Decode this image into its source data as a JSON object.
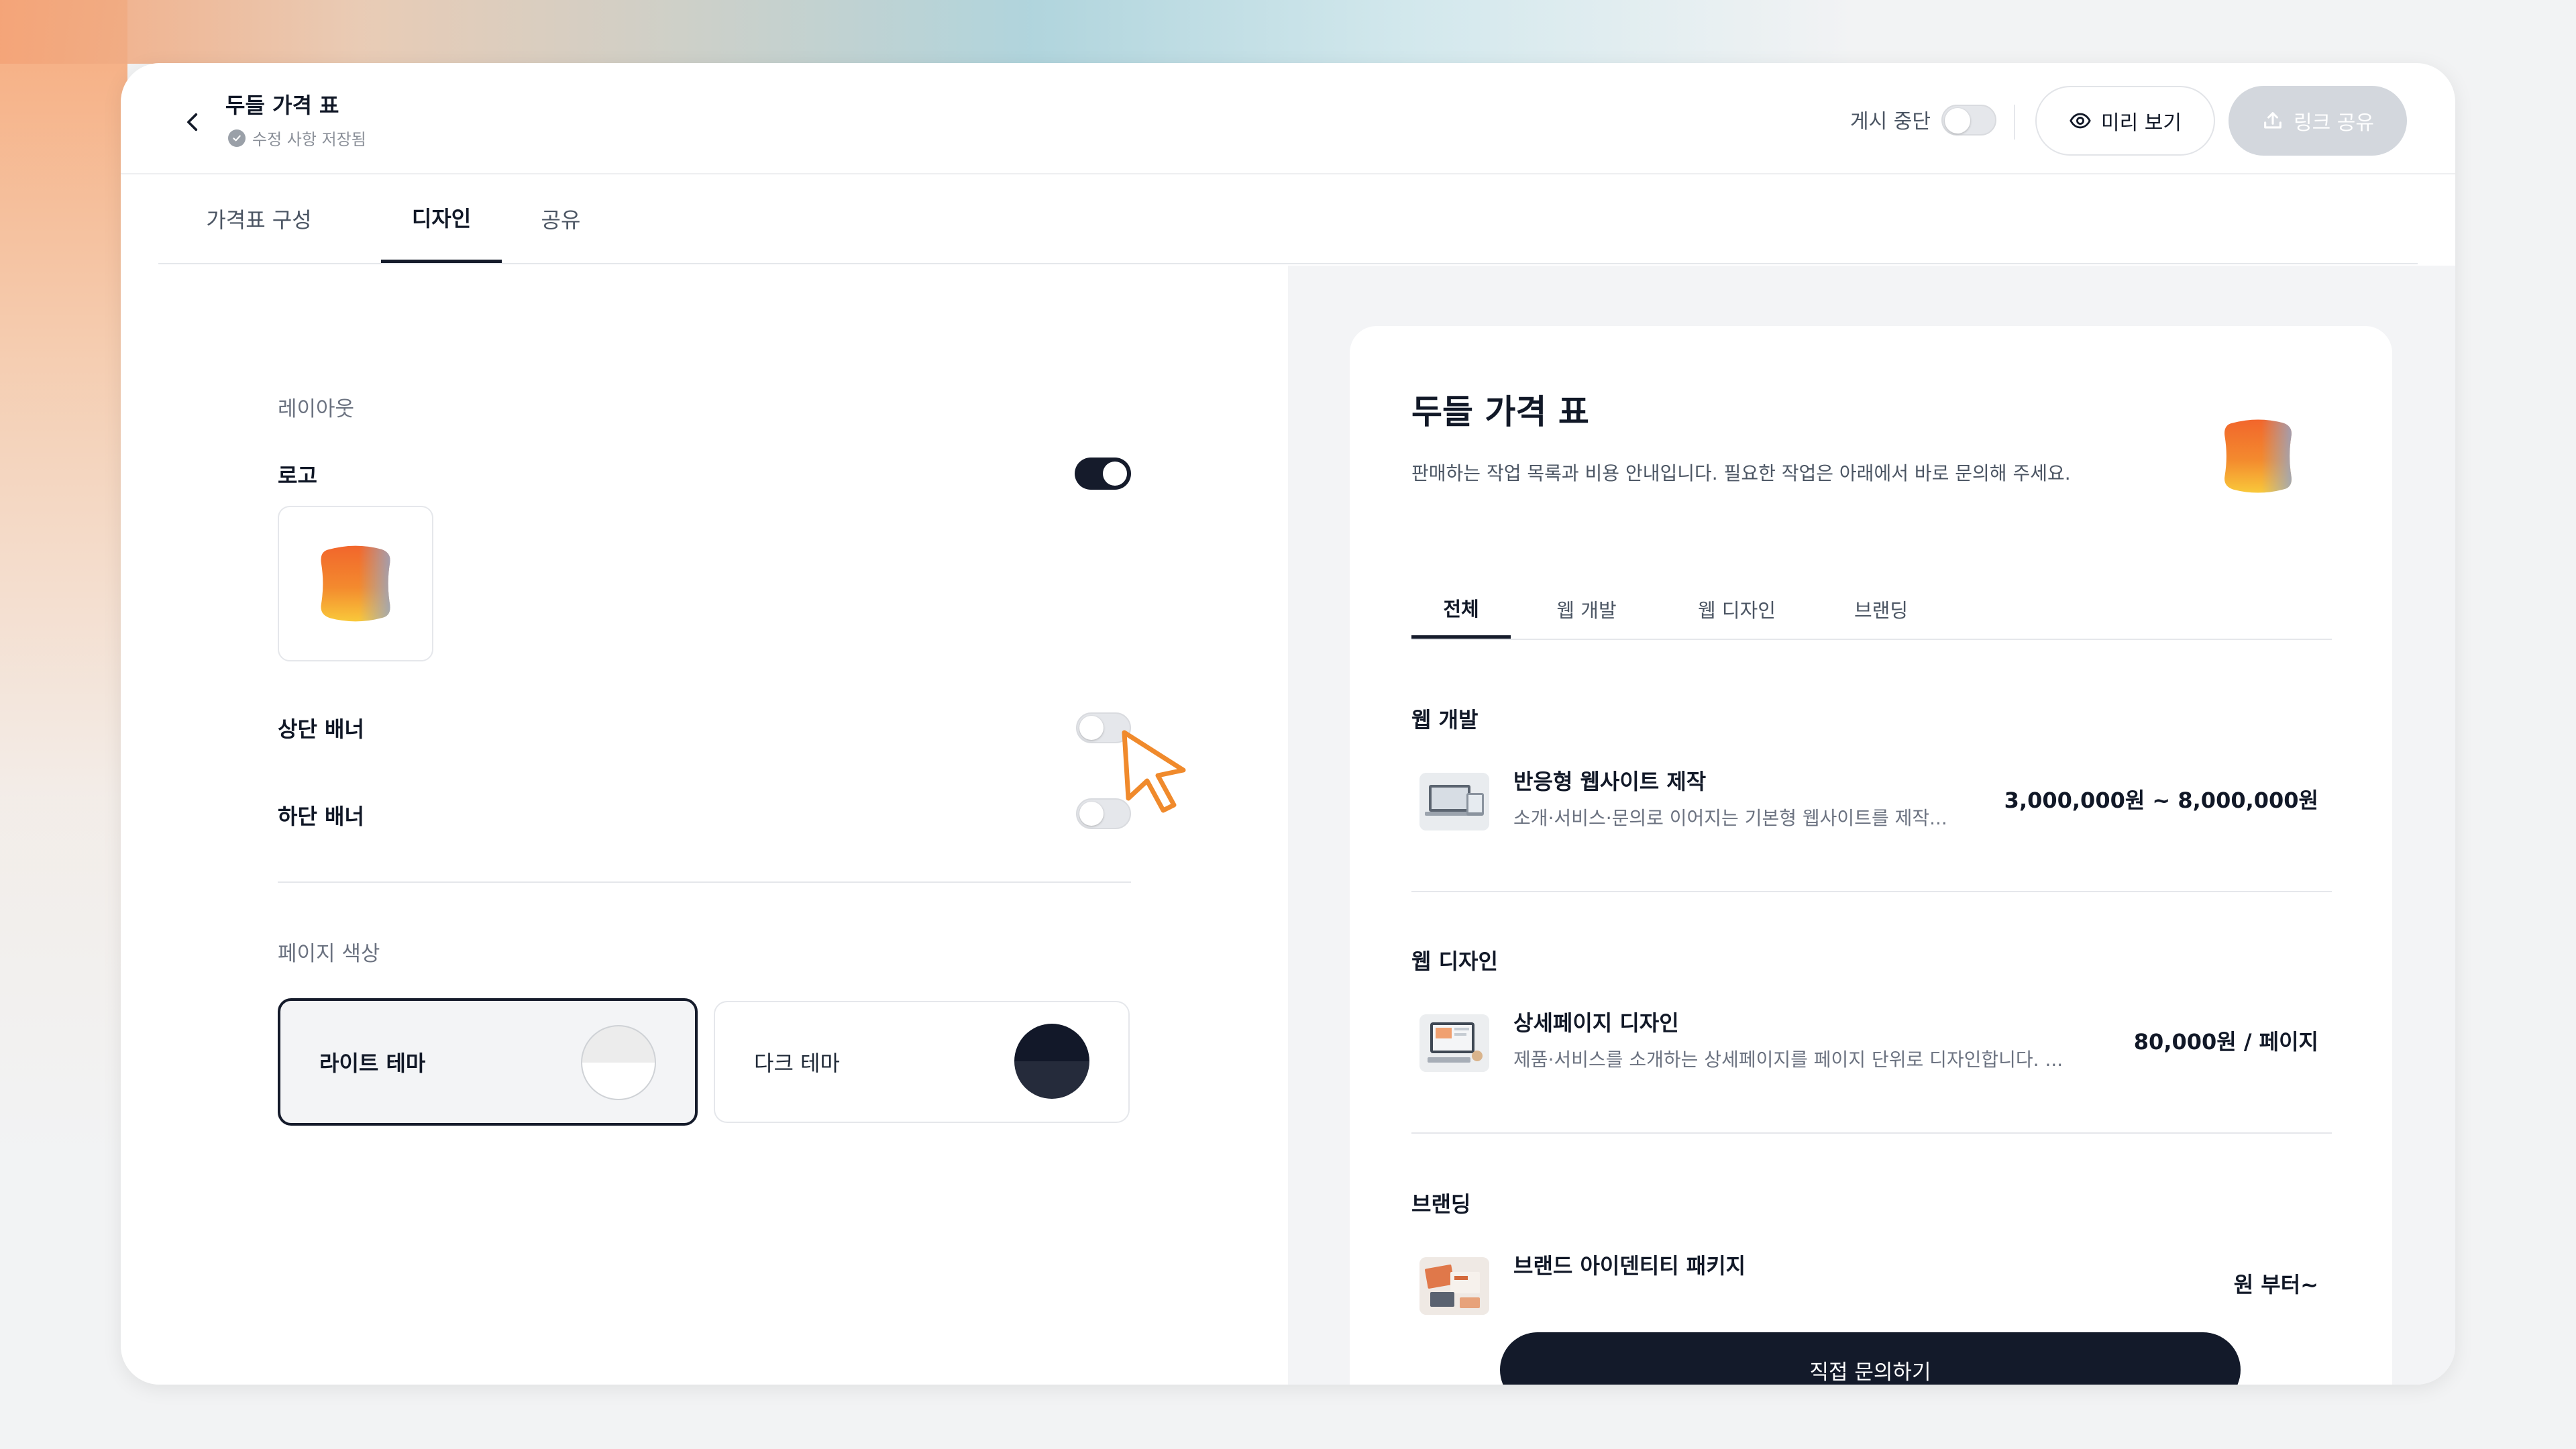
{
  "header": {
    "title": "두들 가격 표",
    "save_status": "수정 사항 저장됨",
    "pause_label": "게시 중단",
    "preview_label": "미리 보기",
    "share_label": "링크 공유"
  },
  "tabs": [
    {
      "label": "가격표 구성"
    },
    {
      "label": "디자인",
      "active": true
    },
    {
      "label": "공유"
    }
  ],
  "design": {
    "layout_label": "레이아웃",
    "logo_label": "로고",
    "logo_enabled": true,
    "top_banner_label": "상단 배너",
    "top_banner_enabled": false,
    "bottom_banner_label": "하단 배너",
    "bottom_banner_enabled": false,
    "page_color_label": "페이지 색상",
    "light_theme_label": "라이트 테마",
    "dark_theme_label": "다크 테마",
    "selected_theme": "light"
  },
  "preview": {
    "title": "두들 가격 표",
    "description": "판매하는 작업 목록과 비용 안내입니다. 필요한 작업은 아래에서 바로 문의해 주세요.",
    "tabs": [
      {
        "label": "전체",
        "active": true
      },
      {
        "label": "웹 개발"
      },
      {
        "label": "웹 디자인"
      },
      {
        "label": "브랜딩"
      }
    ],
    "categories": [
      {
        "name": "웹 개발",
        "item_name": "반응형 웹사이트 제작",
        "item_desc": "소개·서비스·문의로 이어지는 기본형 웹사이트를 제작...",
        "item_price": "3,000,000원 ~ 8,000,000원"
      },
      {
        "name": "웹 디자인",
        "item_name": "상세페이지 디자인",
        "item_desc": "제품·서비스를 소개하는 상세페이지를 페이지 단위로 디자인합니다. ...",
        "item_price": "80,000원 / 페이지"
      },
      {
        "name": "브랜딩",
        "item_name": "브랜드 아이덴티티 패키지",
        "item_price": "원 부터~"
      }
    ],
    "contact_label": "직접 문의하기"
  },
  "colors": {
    "primary_dark": "#151b2b",
    "logo_orange": "#f26a2e",
    "logo_yellow": "#f7b733"
  }
}
